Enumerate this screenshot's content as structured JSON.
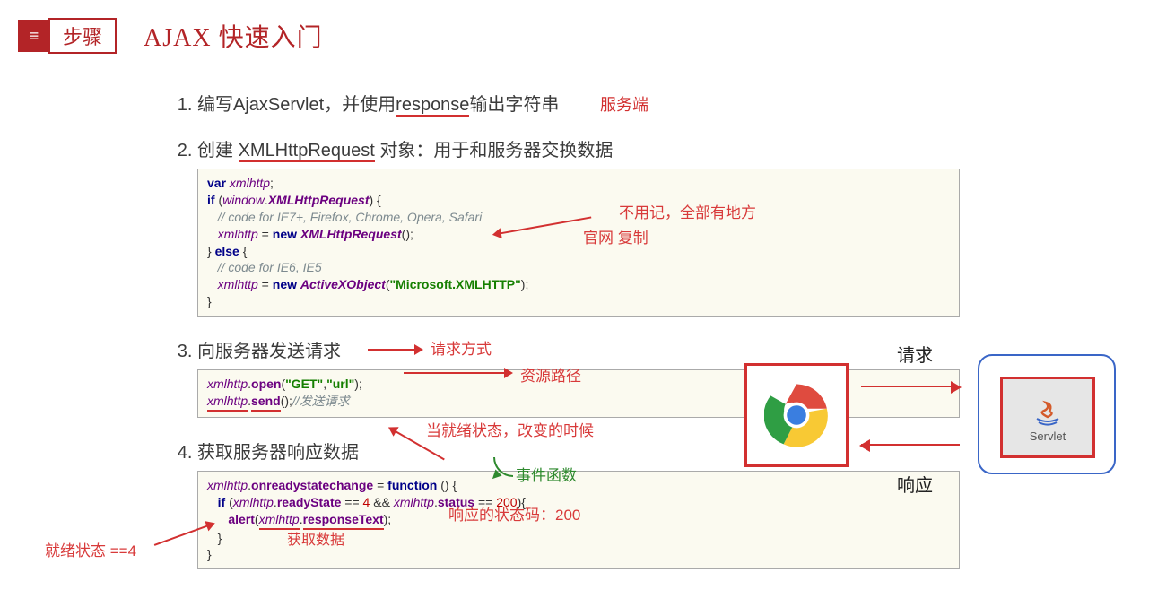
{
  "badge": {
    "icon": "≡",
    "label": "步骤"
  },
  "title": "AJAX 快速入门",
  "steps": {
    "s1": {
      "pre": "编写AjaxServlet，并使用",
      "ul": "response",
      "post": "输出字符串",
      "side": "服务端"
    },
    "s2": {
      "pre": "创建 ",
      "ul": "XMLHttpRequest",
      "post": " 对象：用于和服务器交换数据",
      "anno1": "不用记，全部有地方",
      "anno2": "官网  复制"
    },
    "s3": {
      "text": "向服务器发送请求",
      "anno1": "请求方式",
      "anno2": "资源路径"
    },
    "s4": {
      "text": "获取服务器响应数据",
      "anno1": "当就绪状态，改变的时候",
      "anno2": "事件函数",
      "anno3": "响应的状态码：200",
      "anno4": "就绪状态 ==4",
      "anno5": "获取数据"
    }
  },
  "code1": {
    "l1_var": "var",
    "l1_obj": "xmlhttp",
    "l2_if": "if",
    "l2_win": "window",
    "l2_xhr": "XMLHttpRequest",
    "l3_cmt": "// code for IE7+, Firefox, Chrome, Opera, Safari",
    "l4_obj": "xmlhttp",
    "l4_new": "new",
    "l4_xhr": "XMLHttpRequest",
    "l5_else": "else",
    "l6_cmt": "// code for IE6, IE5",
    "l7_obj": "xmlhttp",
    "l7_new": "new",
    "l7_axo": "ActiveXObject",
    "l7_str": "\"Microsoft.XMLHTTP\""
  },
  "code2": {
    "l1_obj": "xmlhttp",
    "l1_open": "open",
    "l1_get": "\"GET\"",
    "l1_url": "\"url\"",
    "l2_obj": "xmlhttp",
    "l2_send": "send",
    "l2_cmt": "//发送请求"
  },
  "code3": {
    "l1_obj": "xmlhttp",
    "l1_orsc": "onreadystatechange",
    "l1_fn": "function",
    "l2_if": "if",
    "l2_obj1": "xmlhttp",
    "l2_rs": "readyState",
    "l2_eq4": "4",
    "l2_and": "&&",
    "l2_obj2": "xmlhttp",
    "l2_st": "status",
    "l2_eq200": "200",
    "l3_alert": "alert",
    "l3_obj": "xmlhttp",
    "l3_rt": "responseText"
  },
  "diagram": {
    "req": "请求",
    "res": "响应",
    "servlet": "Servlet"
  }
}
